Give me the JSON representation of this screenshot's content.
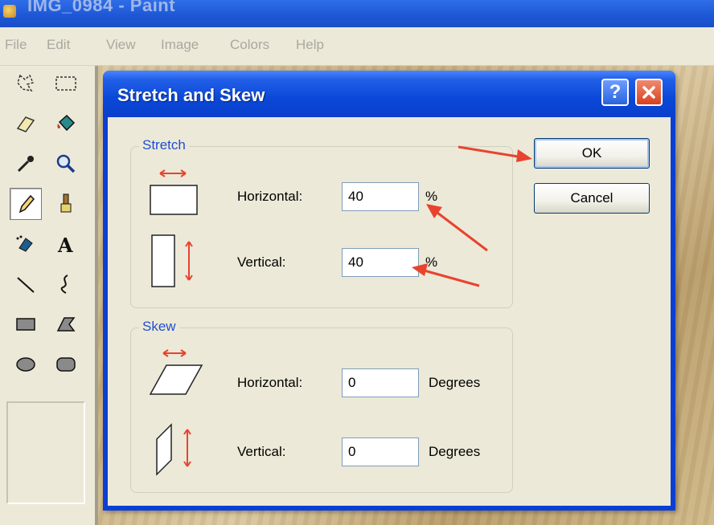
{
  "window": {
    "title": "IMG_0984 - Paint"
  },
  "menu": {
    "items": [
      "File",
      "Edit",
      "View",
      "Image",
      "Colors",
      "Help"
    ]
  },
  "toolbox": {
    "tools": [
      "free-select",
      "rect-select",
      "eraser",
      "fill",
      "color-picker",
      "magnifier",
      "pencil",
      "brush",
      "airbrush",
      "text",
      "line",
      "curve",
      "rectangle",
      "polygon",
      "ellipse",
      "rounded-rectangle"
    ],
    "selected": "pencil"
  },
  "dialog": {
    "title": "Stretch and Skew",
    "help_label": "?",
    "ok_label": "OK",
    "cancel_label": "Cancel",
    "stretch": {
      "label": "Stretch",
      "horizontal_label": "Horizontal:",
      "horizontal_value": "40",
      "horizontal_unit": "%",
      "vertical_label": "Vertical:",
      "vertical_value": "40",
      "vertical_unit": "%"
    },
    "skew": {
      "label": "Skew",
      "horizontal_label": "Horizontal:",
      "horizontal_value": "0",
      "horizontal_unit": "Degrees",
      "vertical_label": "Vertical:",
      "vertical_value": "0",
      "vertical_unit": "Degrees"
    }
  },
  "colors": {
    "accent": "#0a48d8",
    "annotation_arrow": "#e8432f"
  }
}
